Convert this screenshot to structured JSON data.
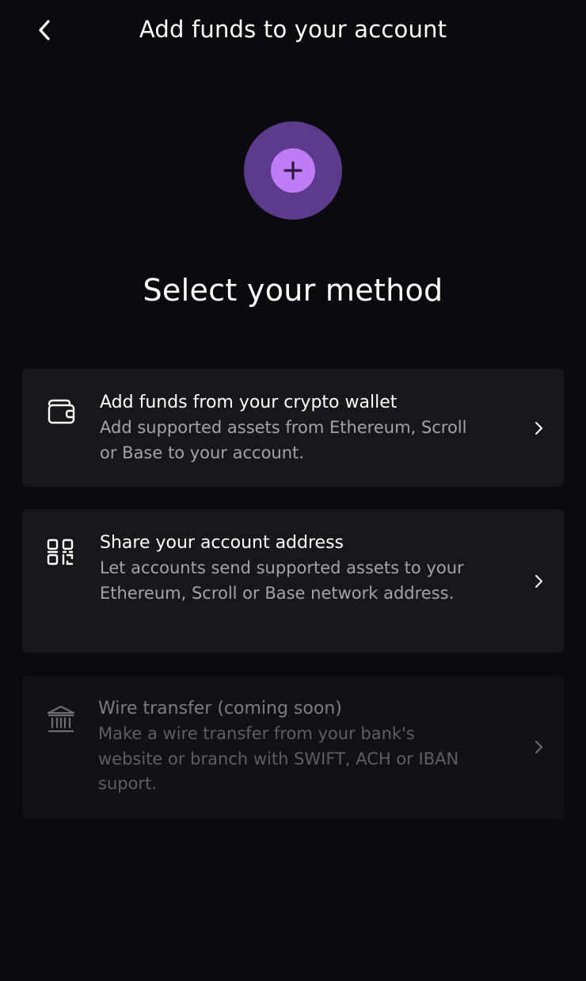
{
  "header": {
    "title": "Add funds to your account",
    "back_icon": "chevron-left-icon"
  },
  "hero": {
    "icon": "plus-icon",
    "outer_color": "#5c3a8c",
    "inner_color": "#c07cf7"
  },
  "section_title": "Select your method",
  "methods": [
    {
      "icon": "wallet-icon",
      "title": "Add funds from your crypto wallet",
      "description": "Add supported assets from Ethereum, Scroll or Base to your account.",
      "enabled": true
    },
    {
      "icon": "qr-code-icon",
      "title": "Share your account address",
      "description": "Let accounts send supported assets to your Ethereum, Scroll or Base network address.",
      "enabled": true
    },
    {
      "icon": "bank-icon",
      "title": "Wire transfer (coming soon)",
      "description": "Make a wire transfer from your bank's website or branch with SWIFT, ACH or IBAN suport.",
      "enabled": false
    }
  ],
  "colors": {
    "background": "#0a0a0f",
    "card": "#17171c",
    "card_disabled": "#121216",
    "accent": "#c07cf7",
    "text_secondary": "#a3a3aa"
  }
}
